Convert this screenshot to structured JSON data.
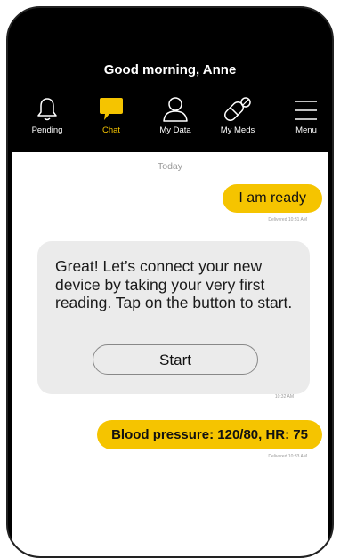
{
  "header": {
    "greeting": "Good morning, Anne"
  },
  "nav": {
    "items": [
      {
        "label": "Pending",
        "icon": "bell-icon"
      },
      {
        "label": "Chat",
        "icon": "chat-bubble-icon",
        "active": true
      },
      {
        "label": "My Data",
        "icon": "user-icon"
      },
      {
        "label": "My Meds",
        "icon": "pill-icon"
      },
      {
        "label": "Menu",
        "icon": "hamburger-menu-icon"
      }
    ]
  },
  "chat": {
    "date_label": "Today",
    "messages": [
      {
        "from": "user",
        "text": "I am ready",
        "meta": "Delivered 10:31 AM"
      },
      {
        "from": "bot",
        "text": "Great! Let’s connect your new device by taking your very first reading. Tap on the button to start.",
        "button": "Start",
        "meta": "10:32 AM"
      },
      {
        "from": "user",
        "text": "Blood pressure: 120/80, HR: 75",
        "meta": "Delivered 10:33 AM"
      }
    ]
  },
  "colors": {
    "accent": "#f5c400",
    "header_bg": "#000000",
    "bot_bubble": "#ebebeb"
  }
}
